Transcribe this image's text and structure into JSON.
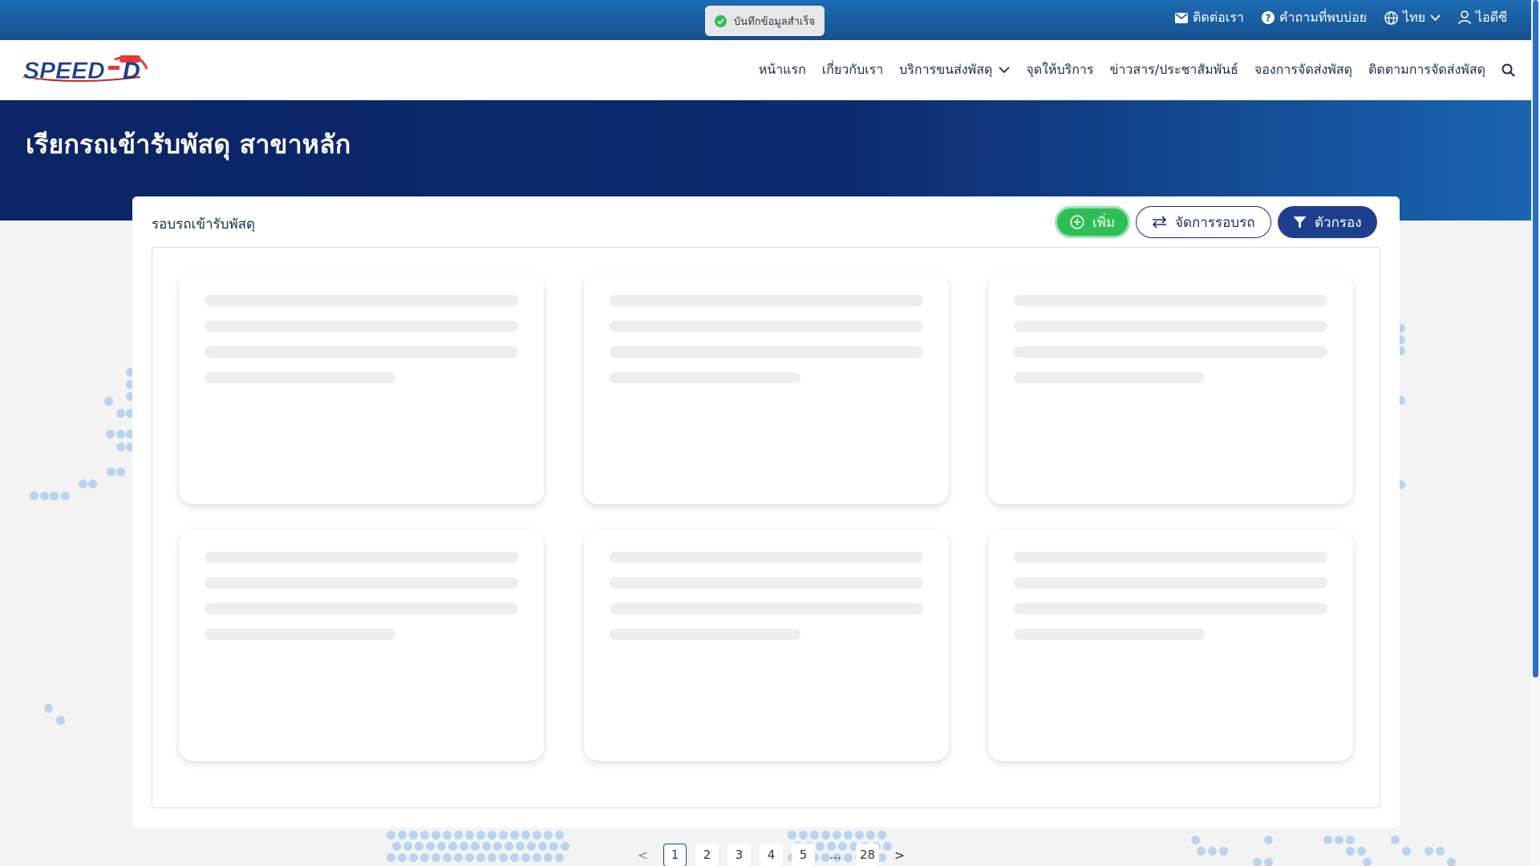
{
  "toast": {
    "message": "บันทึกข้อมูลสำเร็จ",
    "color": "#2fbe56"
  },
  "topbar": {
    "contact": "ติดต่อเรา",
    "faq": "คำถามที่พบบ่อย",
    "language": "ไทย",
    "user": "ไอดีซี"
  },
  "brand": {
    "logo_text": "SPEED-D",
    "logo_badge": "SPEED"
  },
  "nav": {
    "items": [
      {
        "label": "หน้าแรก"
      },
      {
        "label": "เกี่ยวกับเรา"
      },
      {
        "label": "บริการขนส่งพัสดุ"
      },
      {
        "label": "จุดให้บริการ"
      },
      {
        "label": "ข่าวสาร/ประชาสัมพันธ์"
      },
      {
        "label": "จองการจัดส่งพัสดุ"
      },
      {
        "label": "ติดตามการจัดส่งพัสดุ"
      }
    ]
  },
  "hero": {
    "title": "เรียกรถเข้ารับพัสดุ สาขาหลัก"
  },
  "panel": {
    "title": "รอบรถเข้ารับพัสดุ",
    "add_label": "เพิ่ม",
    "manage_label": "จัดการรอบรถ",
    "filter_label": "ตัวกรอง"
  },
  "pagination": {
    "pages": [
      "1",
      "2",
      "3",
      "4",
      "5",
      "...",
      "28"
    ],
    "current": "1",
    "prev": "<",
    "next": ">"
  },
  "colors": {
    "primary": "#1d3f8e",
    "hero": "#0b2465",
    "accent": "#2fbe56"
  }
}
